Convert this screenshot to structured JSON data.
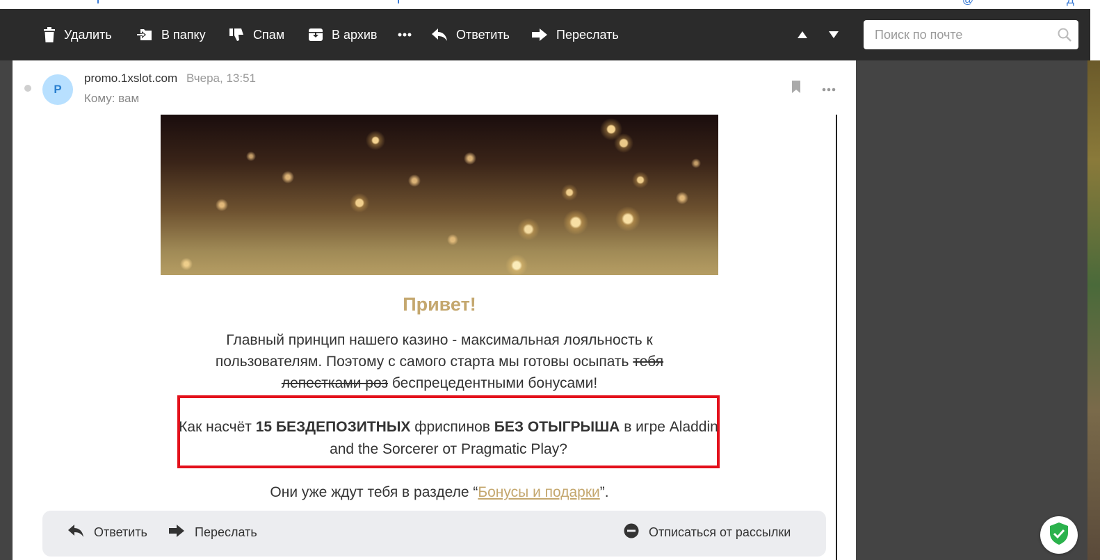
{
  "toolbar": {
    "delete_label": "Удалить",
    "move_label": "В папку",
    "spam_label": "Спам",
    "archive_label": "В архив",
    "reply_label": "Ответить",
    "forward_label": "Переслать",
    "icons": [
      "trash-icon",
      "folder-move-icon",
      "thumbs-down-icon",
      "archive-icon",
      "more-icon",
      "reply-icon",
      "forward-icon",
      "arrow-up-icon",
      "arrow-down-icon"
    ]
  },
  "search": {
    "placeholder": "Поиск по почте",
    "icon": "search-icon"
  },
  "message": {
    "avatar_letter": "P",
    "sender": "promo.1xslot.com",
    "date": "Вчера, 13:51",
    "to": "Кому: вам",
    "header_icons": [
      "bookmark-icon",
      "more-icon"
    ],
    "body": {
      "greeting": "Привет!",
      "para_start": "Главный принцип нашего казино - максимальная лояльность к пользователям. Поэтому с самого старта мы готовы осыпать ",
      "para_struck": "тебя лепестками роз",
      "para_end": " беспрецедентными бонусами!",
      "offer_1": "Как насчёт ",
      "offer_bold_1": "15 БЕЗДЕПОЗИТНЫХ",
      "offer_2": " фриспинов ",
      "offer_bold_2": "БЕЗ ОТЫГРЫША",
      "offer_3": " в игре Aladdin and the Sorcerer  от Pragmatic Play?",
      "where_start": "Они уже ждут тебя в разделе “",
      "where_link": "Бонусы и подарки",
      "where_end": "”."
    }
  },
  "bottom_bar": {
    "reply_label": "Ответить",
    "forward_label": "Переслать",
    "unsubscribe_label": "Отписаться от рассылки"
  },
  "colors": {
    "toolbar_bg": "#2b2b2b",
    "accent_gold": "#c4a76e",
    "highlight_red": "#e3101b",
    "avatar_bg": "#b8e0ff",
    "shield_green": "#2bb24c"
  }
}
